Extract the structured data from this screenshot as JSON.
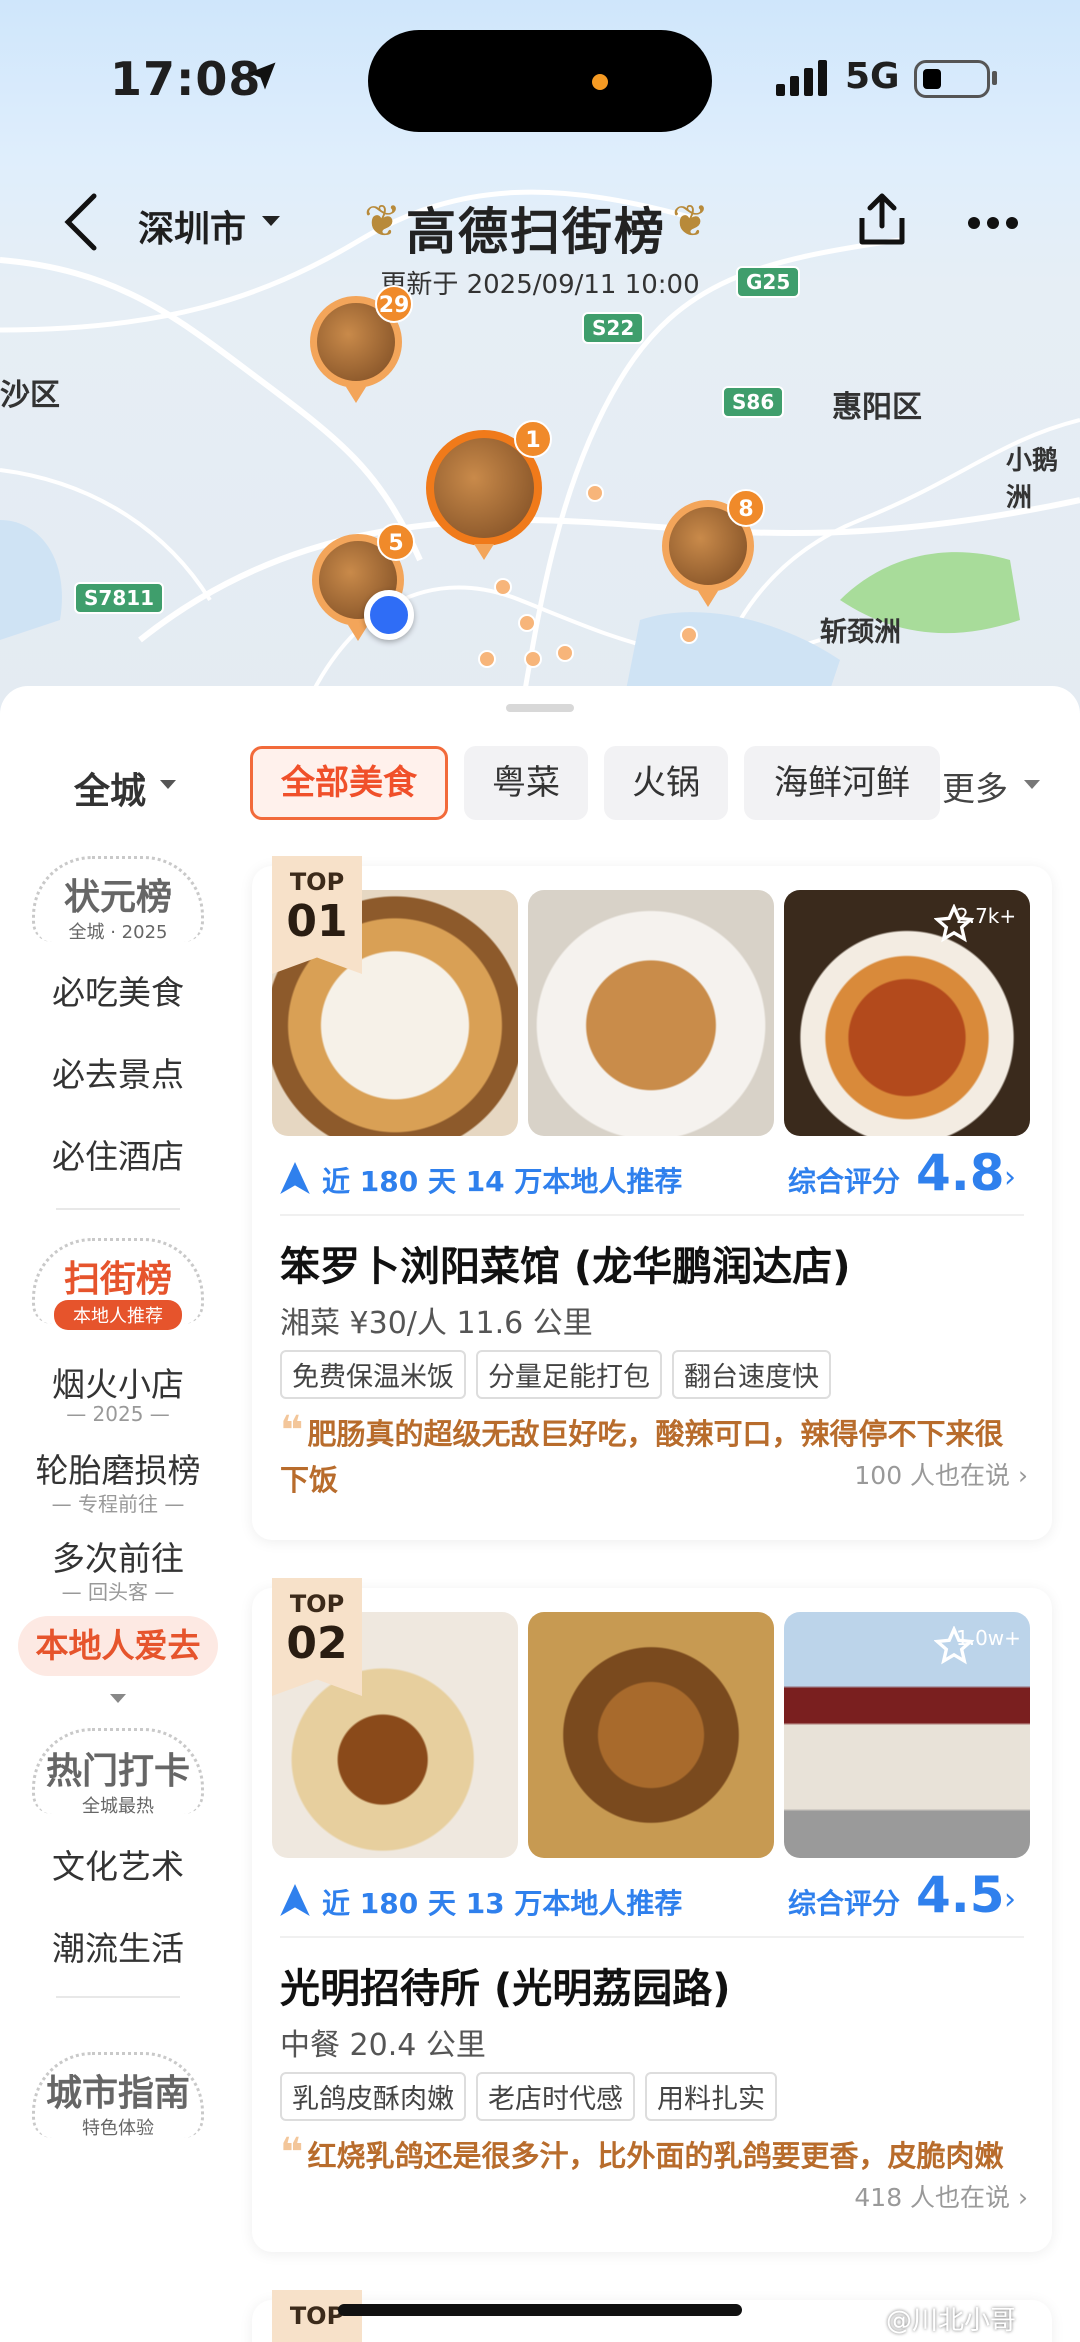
{
  "status": {
    "time": "17:08",
    "network": "5G"
  },
  "header": {
    "city": "深圳市",
    "brand": "高德扫街榜",
    "updated": "更新于 2025/09/11 10:00"
  },
  "map": {
    "places": [
      "沙区",
      "惠阳区",
      "小鹅洲",
      "斩颈洲"
    ],
    "roads": [
      "G25",
      "S22",
      "S86",
      "S7811"
    ],
    "pins": [
      "29",
      "1",
      "5",
      "8"
    ]
  },
  "filters": {
    "scope": "全城",
    "chips": [
      "全部美食",
      "粤菜",
      "火锅",
      "海鲜河鲜"
    ],
    "more": "更多"
  },
  "sidebar": {
    "badge1": {
      "title": "状元榜",
      "sub": "全城 · 2025"
    },
    "items1": [
      "必吃美食",
      "必去景点",
      "必住酒店"
    ],
    "badge2": {
      "title": "扫街榜",
      "sub": "本地人推荐"
    },
    "items2": [
      {
        "label": "烟火小店",
        "sub": "— 2025 —"
      },
      {
        "label": "轮胎磨损榜",
        "sub": "— 专程前往 —"
      },
      {
        "label": "多次前往",
        "sub": "— 回头客 —"
      }
    ],
    "selected": "本地人爱去",
    "badge3": {
      "title": "热门打卡",
      "sub": "全城最热"
    },
    "items3": [
      "文化艺术",
      "潮流生活"
    ],
    "badge4": {
      "title": "城市指南",
      "sub": "特色体验"
    }
  },
  "cards": [
    {
      "rank_top": "TOP",
      "rank_num": "01",
      "favorites": "2.7k+",
      "recommend": "近 180 天 14 万本地人推荐",
      "score_label": "综合评分",
      "score": "4.8",
      "name": "笨罗卜浏阳菜馆 (龙华鹏润达店)",
      "meta": "湘菜  ¥30/人  11.6 公里",
      "tags": [
        "免费保温米饭",
        "分量足能打包",
        "翻台速度快"
      ],
      "quote": "肥肠真的超级无敌巨好吃，酸辣可口，辣得停不下来很下饭",
      "said": "100 人也在说 ›"
    },
    {
      "rank_top": "TOP",
      "rank_num": "02",
      "favorites": "1.0w+",
      "recommend": "近 180 天 13 万本地人推荐",
      "score_label": "综合评分",
      "score": "4.5",
      "name": "光明招待所 (光明荔园路)",
      "meta": "中餐  20.4 公里",
      "tags": [
        "乳鸽皮酥肉嫩",
        "老店时代感",
        "用料扎实"
      ],
      "quote": "红烧乳鸽还是很多汁，比外面的乳鸽要更香，皮脆肉嫩",
      "said": "418 人也在说 ›"
    }
  ],
  "peek": {
    "rank_top": "TOP"
  },
  "watermark": "@川北小哥",
  "colors": {
    "accent": "#f0502a",
    "blue": "#2f80ed",
    "gold": "#b86c2c"
  }
}
